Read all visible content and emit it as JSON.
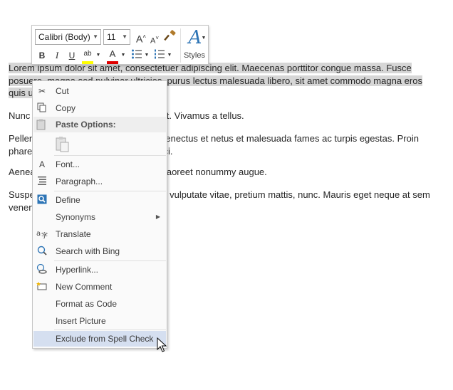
{
  "document": {
    "p1_lines": [
      "Lorem ipsum dolor sit amet, consectetuer adipiscing elit. Maecenas porttitor congue massa. Fusce",
      "posuere, magna sed pulvinar ultricies, purus lectus malesuada libero, sit amet commodo magna eros",
      "quis urna."
    ],
    "p2_lines": [
      "Nunc viverra imperdiet enim. Fusce est. Vivamus a tellus."
    ],
    "p3_lines": [
      "Pellentesque habitant morbi tristique senectus et netus et malesuada fames ac turpis egestas. Proin",
      "pharetra nonummy pede. Mauris et orci."
    ],
    "p4_lines": [
      "Aenean nec lorem. In porttitor. Donec laoreet nonummy augue."
    ],
    "p5_lines": [
      "Suspendisse dui purus, scelerisque at, vulputate vitae, pretium mattis, nunc. Mauris eget neque at sem",
      "venenatis eleifend. Ut nonummy."
    ],
    "selection_color": "#d6d6d6"
  },
  "mini_toolbar": {
    "font_name": "Calibri (Body)",
    "font_size": "11",
    "grow_font": "A",
    "shrink_font": "A",
    "bold": "B",
    "italic": "I",
    "underline": "U",
    "highlight": "ab",
    "font_color": "A",
    "styles_label": "Styles",
    "highlight_color": "#ffff00",
    "font_color_value": "#e00000"
  },
  "context_menu": {
    "cut": "Cut",
    "copy": "Copy",
    "paste_options": "Paste Options:",
    "font": "Font...",
    "paragraph": "Paragraph...",
    "define": "Define",
    "synonyms": "Synonyms",
    "translate": "Translate",
    "search_bing": "Search with Bing",
    "hyperlink": "Hyperlink...",
    "new_comment": "New Comment",
    "format_code": "Format as Code",
    "insert_picture": "Insert Picture",
    "exclude_spell": "Exclude from Spell Check",
    "highlight_color": "#d5dff0"
  }
}
